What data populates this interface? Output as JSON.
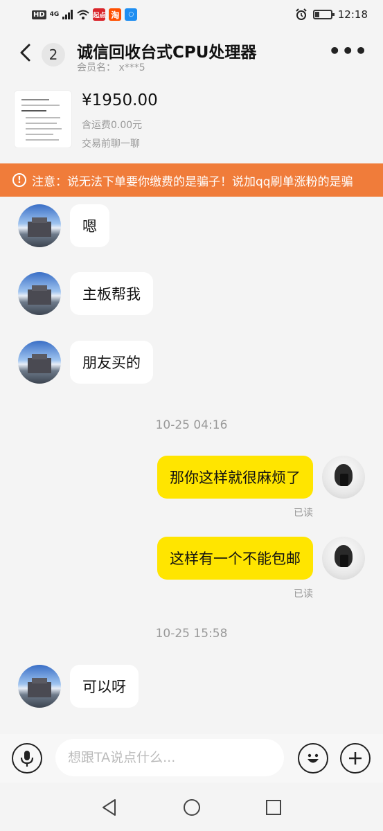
{
  "status_bar": {
    "network_label": "HD",
    "network_type": "4G",
    "app1_label": "起点",
    "app2_label": "淘",
    "time": "12:18"
  },
  "header": {
    "unread_count": "2",
    "title": "诚信回收台式CPU处理器",
    "member_name": "会员名： x***5"
  },
  "product": {
    "price": "¥1950.00",
    "shipping": "含运费0.00元",
    "chat_hint": "交易前聊一聊"
  },
  "notice": {
    "text": "注意：说无法下单要你缴费的是骗子！说加qq刷单涨粉的是骗"
  },
  "messages": [
    {
      "text": "嗯"
    },
    {
      "text": "主板帮我"
    },
    {
      "text": "朋友买的"
    },
    {
      "timestamp": "10-25 04:16"
    },
    {
      "text": "那你这样就很麻烦了",
      "status": "已读"
    },
    {
      "text": "这样有一个不能包邮",
      "status": "已读"
    },
    {
      "timestamp": "10-25 15:58"
    },
    {
      "text": "可以呀"
    }
  ],
  "input": {
    "placeholder": "想跟TA说点什么..."
  },
  "colors": {
    "accent_yellow": "#ffe500",
    "notice_orange": "#f07c3a"
  },
  "icons": [
    "back-arrow-icon",
    "more-icon",
    "microphone-icon",
    "emoji-icon",
    "plus-icon",
    "nav-back-icon",
    "nav-home-icon",
    "nav-recents-icon"
  ]
}
